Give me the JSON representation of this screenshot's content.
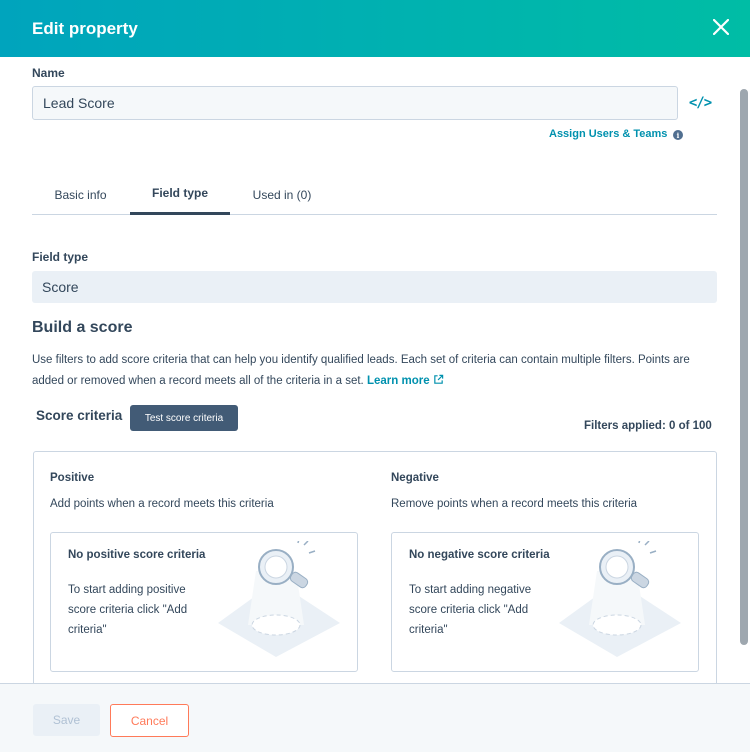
{
  "header": {
    "title": "Edit property",
    "close_icon": "close-icon"
  },
  "name_field": {
    "label": "Name",
    "value": "Lead Score",
    "code_icon": "code-icon"
  },
  "assign": {
    "label": "Assign Users & Teams",
    "info_icon": "info-icon"
  },
  "tabs": [
    {
      "label": "Basic info",
      "active": false
    },
    {
      "label": "Field type",
      "active": true
    },
    {
      "label": "Used in (0)",
      "active": false
    }
  ],
  "field_type": {
    "label": "Field type",
    "value": "Score"
  },
  "build": {
    "title": "Build a score",
    "description": "Use filters to add score criteria that can help you identify qualified leads. Each set of criteria can contain multiple filters. Points are added or removed when a record meets all of the criteria in a set.",
    "learn_more": "Learn more",
    "criteria_label": "Score criteria",
    "test_button": "Test score criteria",
    "filters_applied": "Filters applied: 0 of 100"
  },
  "positive": {
    "title": "Positive",
    "subtitle": "Add points when a record meets this criteria",
    "empty_title": "No positive score criteria",
    "empty_text": "To start adding positive score criteria click \"Add criteria\""
  },
  "negative": {
    "title": "Negative",
    "subtitle": "Remove points when a record meets this criteria",
    "empty_title": "No negative score criteria",
    "empty_text": "To start adding negative score criteria click \"Add criteria\""
  },
  "footer": {
    "save": "Save",
    "cancel": "Cancel"
  },
  "colors": {
    "header_start": "#00a4bd",
    "header_end": "#00bda5",
    "link": "#0091ae",
    "cancel": "#ff7a59",
    "dark_button": "#425b76"
  }
}
